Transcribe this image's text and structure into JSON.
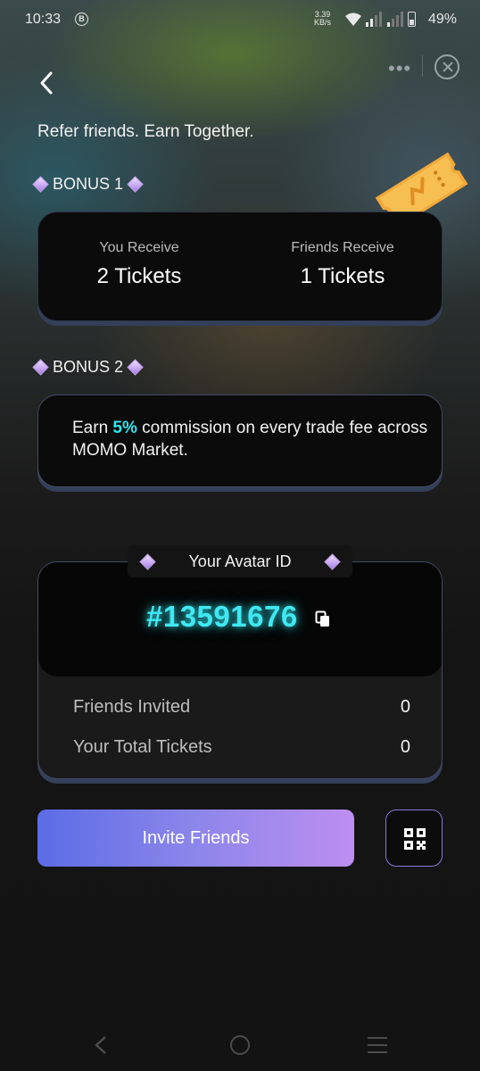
{
  "status_bar": {
    "time": "10:33",
    "b_icon": "B",
    "net_speed_value": "3.39",
    "net_speed_unit": "KB/s",
    "battery": "49%"
  },
  "header": {
    "headline": "Refer friends. Earn Together."
  },
  "bonus1": {
    "label": "BONUS 1",
    "you_receive_label": "You Receive",
    "you_receive_value": "2 Tickets",
    "friends_receive_label": "Friends Receive",
    "friends_receive_value": "1 Tickets"
  },
  "bonus2": {
    "label": "BONUS 2",
    "text_before": "Earn ",
    "highlight": "5%",
    "text_after": " commission on every trade fee across MOMO Market."
  },
  "avatar": {
    "tab_label": "Your Avatar ID",
    "id": "#13591676"
  },
  "stats": [
    {
      "label": "Friends Invited",
      "value": "0"
    },
    {
      "label": "Your Total Tickets",
      "value": "0"
    }
  ],
  "actions": {
    "invite_label": "Invite Friends"
  },
  "icons": {
    "back": "chevron-left-icon",
    "more": "more-dots-icon",
    "close": "close-circle-icon",
    "copy": "copy-icon",
    "qr": "qr-code-icon",
    "ticket": "ticket-icon"
  },
  "colors": {
    "accent_cyan": "#2ee5ee",
    "gradient_start": "#5b6ce6",
    "gradient_end": "#bd8ef0",
    "card_border": "#434a66"
  }
}
